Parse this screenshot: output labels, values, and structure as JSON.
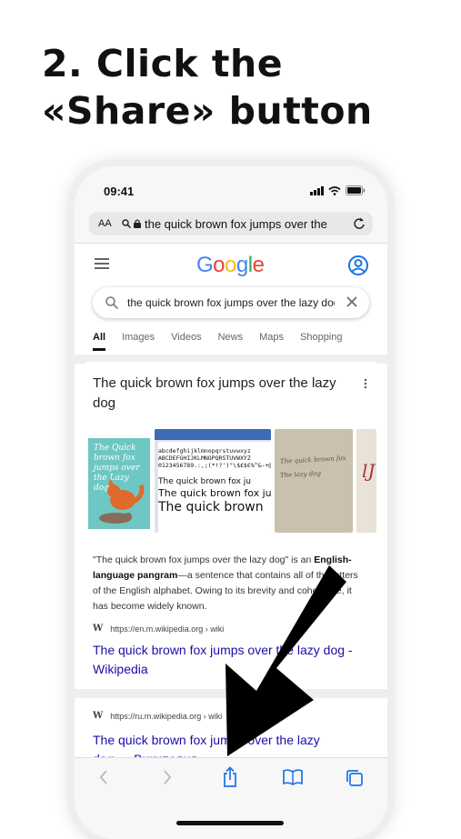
{
  "heading": "2. Click the\n«Share» button",
  "status": {
    "time": "09:41"
  },
  "address_bar": {
    "aa": "AA",
    "url": "the quick brown fox jumps over the"
  },
  "google": {
    "logo_letters": [
      {
        "ch": "G",
        "color": "#4285F4"
      },
      {
        "ch": "o",
        "color": "#EA4335"
      },
      {
        "ch": "o",
        "color": "#FBBC05"
      },
      {
        "ch": "g",
        "color": "#4285F4"
      },
      {
        "ch": "l",
        "color": "#34A853"
      },
      {
        "ch": "e",
        "color": "#EA4335"
      }
    ],
    "query": "the quick brown fox jumps over the lazy dog",
    "tabs": [
      "All",
      "Images",
      "Videos",
      "News",
      "Maps",
      "Shopping"
    ]
  },
  "result1": {
    "title": "The quick brown fox jumps over the lazy dog",
    "image_text": {
      "book1": "The Quick brown fox jumps over the Lazy dog",
      "font_sample_lines": [
        "abcdefghijklmnopqrstuvwxyz",
        "ABCDEFGHIJKLMNOPQRSTUVWXYZ",
        "0123456789.:,;(*!?')\"\\$£$€%^&-+@"
      ],
      "font_sample_big": [
        "The quick brown fox ju",
        "The quick brown fox ju",
        "The quick brown"
      ],
      "handwriting": [
        "The quick brown fox",
        "The lazy dog"
      ],
      "fourth": "lJ"
    },
    "description_pre": "\"The quick brown fox jumps over the lazy dog\" is an ",
    "description_bold": "English-language pangram",
    "description_post": "—a sentence that contains all of the letters of the English alphabet. Owing to its brevity and coherence, it has become widely known.",
    "source_logo": "W",
    "source_url": "https://en.m.wikipedia.org › wiki",
    "link": "The quick brown fox jumps over the lazy dog - Wikipedia"
  },
  "result2": {
    "source_logo": "W",
    "source_url": "https://ru.m.wikipedia.org › wiki",
    "link": "The quick brown fox jumps over the lazy\ndog — Википедия"
  },
  "toolbar": {
    "back": "back-icon",
    "forward": "forward-icon",
    "share": "share-icon",
    "bookmarks": "bookmarks-icon",
    "tabs": "tabs-icon"
  },
  "colors": {
    "link": "#1a0dab",
    "google_blue": "#4285F4"
  }
}
